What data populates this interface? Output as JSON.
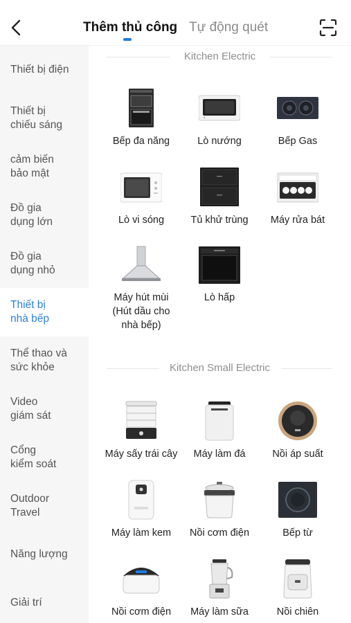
{
  "header": {
    "tabs": [
      {
        "label": "Thêm thủ công",
        "active": true
      },
      {
        "label": "Tự động quét",
        "active": false
      }
    ],
    "accent_color": "#1f7ae0"
  },
  "sidebar": {
    "items": [
      {
        "label": "Thiết bị điện"
      },
      {
        "label": "Thiết bị\nchiếu sáng"
      },
      {
        "label": "cảm biến\nbảo mật"
      },
      {
        "label": "Đồ gia\ndụng lớn"
      },
      {
        "label": "Đồ gia\ndụng nhỏ"
      },
      {
        "label": "Thiết bị\nnhà bếp",
        "active": true
      },
      {
        "label": "Thể thao và\nsức khỏe"
      },
      {
        "label": "Video\ngiám sát"
      },
      {
        "label": "Cổng\nkiểm soát"
      },
      {
        "label": "Outdoor\nTravel"
      },
      {
        "label": "Năng lượng"
      },
      {
        "label": "Giải trí"
      }
    ],
    "active_color": "#2d7fd8"
  },
  "sections": [
    {
      "title": "Kitchen Electric",
      "items": [
        {
          "label": "Bếp đa năng",
          "icon": "multi-cooker-icon"
        },
        {
          "label": "Lò nướng",
          "icon": "oven-icon"
        },
        {
          "label": "Bếp Gas",
          "icon": "gas-stove-icon"
        },
        {
          "label": "Lò vi sóng",
          "icon": "microwave-icon"
        },
        {
          "label": "Tủ khử trùng",
          "icon": "sterilizer-cabinet-icon"
        },
        {
          "label": "Máy rửa bát",
          "icon": "dishwasher-icon"
        },
        {
          "label": "Máy hút mùi\n(Hút dầu cho\nnhà bếp)",
          "icon": "range-hood-icon"
        },
        {
          "label": "Lò hấp",
          "icon": "steam-oven-icon"
        }
      ]
    },
    {
      "title": "Kitchen Small Electric",
      "items": [
        {
          "label": "Máy sấy trái cây",
          "icon": "fruit-dryer-icon"
        },
        {
          "label": "Máy làm đá",
          "icon": "ice-maker-icon"
        },
        {
          "label": "Nồi áp suất",
          "icon": "pressure-cooker-icon"
        },
        {
          "label": "Máy làm kem",
          "icon": "ice-cream-maker-icon"
        },
        {
          "label": "Nồi cơm điện",
          "icon": "rice-cooker-icon"
        },
        {
          "label": "Bếp từ",
          "icon": "induction-cooker-icon"
        },
        {
          "label": "Nồi cơm điện",
          "icon": "rice-cooker-2-icon"
        },
        {
          "label": "Máy làm sữa",
          "icon": "milk-maker-icon"
        },
        {
          "label": "Nồi chiên",
          "icon": "air-fryer-icon"
        }
      ]
    }
  ]
}
